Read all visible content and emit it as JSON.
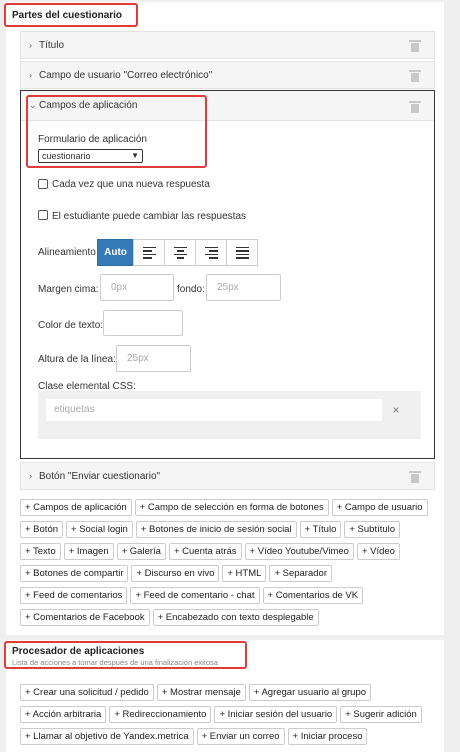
{
  "sections": {
    "parts_title": "Partes del cuestionario",
    "processor_title": "Procesador de aplicaciones",
    "processor_subtitle": "Lista de acciones a tomar después de una finalización exitosa"
  },
  "accordion": {
    "title_row": "Título",
    "email_row": "Campo de usuario \"Correo electrónico\"",
    "app_fields_row": "Campos de aplicación",
    "submit_row": "Botón \"Enviar cuestionario\""
  },
  "app_fields": {
    "form_label": "Formulario de aplicación",
    "form_value": "cuestionario",
    "cb_every_time": "Cada vez que una nueva respuesta",
    "cb_student_change": "El estudiante puede cambiar las respuestas",
    "align_label": "Alineamiento",
    "align_auto": "Auto",
    "margin_top_label": "Margen cima:",
    "margin_top_value": "0px",
    "margin_bottom_label": "fondo:",
    "margin_bottom_value": "25px",
    "text_color_label": "Color de texto:",
    "line_height_label": "Altura de la línea:",
    "line_height_value": "25px",
    "css_class_label": "Clase elemental CSS:",
    "css_class_value": "etiquetas"
  },
  "add_buttons": [
    "+ Campos de aplicación",
    "+ Campo de selección en forma de botones",
    "+ Campo de usuario",
    "+ Botón",
    "+ Social login",
    "+ Botones de inicio de sesión social",
    "+ Título",
    "+ Subtítulo",
    "+ Texto",
    "+ Imagen",
    "+ Galería",
    "+ Cuenta atrás",
    "+ Vídeo Youtube/Vimeo",
    "+ Vídeo",
    "+ Botones de compartir",
    "+ Discurso en vivo",
    "+ HTML",
    "+ Separador",
    "+ Feed de comentarios",
    "+ Feed de comentario - chat",
    "+ Comentarios de VK",
    "+ Comentarios de Facebook",
    "+ Encabezado con texto desplegable"
  ],
  "processor_buttons": [
    "+ Crear una solicitud / pedido",
    "+ Mostrar mensaje",
    "+ Agregar usuario al grupo",
    "+ Acción arbitraria",
    "+ Redireccionamiento",
    "+ Iniciar sesión del usuario",
    "+ Sugerir adición",
    "+ Llamar al objetivo de Yandex.metrica",
    "+ Enviar un correo",
    "+ Iniciar proceso"
  ],
  "colors": {
    "highlight": "#e03b3b",
    "primary": "#337ab7"
  }
}
